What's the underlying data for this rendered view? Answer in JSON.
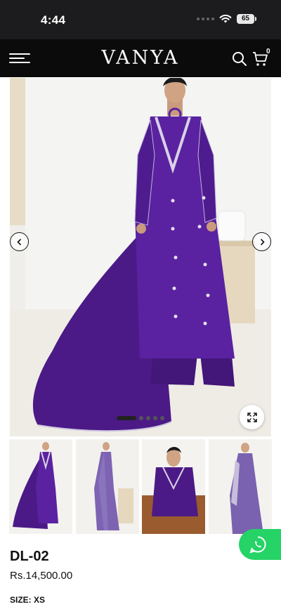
{
  "status_bar": {
    "time": "4:44",
    "battery": "65"
  },
  "header": {
    "logo": "VANYA",
    "cart_count": "0"
  },
  "hero": {
    "carousel_slides": 5,
    "active_slide": 1
  },
  "thumbnails": [
    {
      "name": "full-length-front"
    },
    {
      "name": "side-view"
    },
    {
      "name": "seated-closeup"
    },
    {
      "name": "back-view"
    }
  ],
  "product": {
    "name": "DL-02",
    "price": "Rs.14,500.00",
    "size_label": "SIZE:",
    "size_value": "XS"
  },
  "colors": {
    "dress": "#4b1a86",
    "header_bg": "#0b0b0b",
    "whatsapp": "#25d366"
  }
}
